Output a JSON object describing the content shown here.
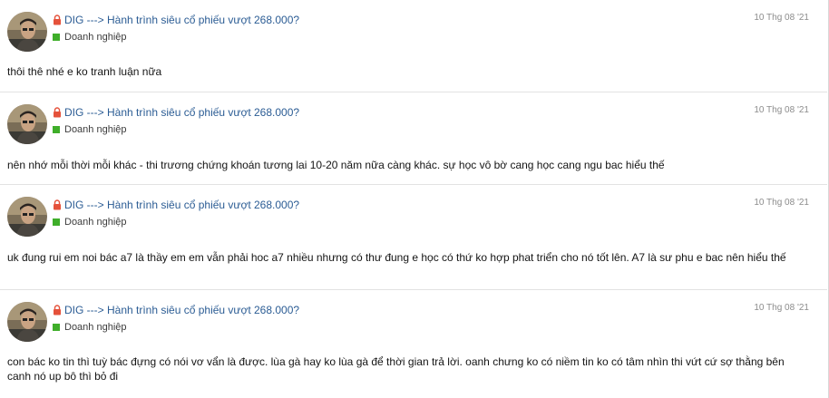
{
  "colors": {
    "link": "#2b5c94",
    "forum_badge": "#3fae2a",
    "lock": "#e5513a",
    "date": "#8c8c8c"
  },
  "posts": [
    {
      "thread_title": "DIG ---> Hành trình siêu cổ phiếu vượt 268.000?",
      "forum": "Doanh nghiệp",
      "date": "10 Thg 08 '21",
      "text": "thôi thê nhé e ko tranh luận nữa",
      "icons": [
        "avatar",
        "lock-icon",
        "forum-badge-icon"
      ]
    },
    {
      "thread_title": "DIG ---> Hành trình siêu cổ phiếu vượt 268.000?",
      "forum": "Doanh nghiệp",
      "date": "10 Thg 08 '21",
      "text": "nên nhớ mỗi thời mỗi khác - thi trương chứng khoán tương lai 10-20 năm nữa càng khác. sự học vô bờ cang học cang ngu bac hiểu thế",
      "icons": [
        "avatar",
        "lock-icon",
        "forum-badge-icon"
      ]
    },
    {
      "thread_title": "DIG ---> Hành trình siêu cổ phiếu vượt 268.000?",
      "forum": "Doanh nghiệp",
      "date": "10 Thg 08 '21",
      "text": "uk đung rui em noi bác a7 là thầy em em vẫn phải hoc a7 nhiều nhưng có thư đung e học có thứ ko hợp phat triển cho nó tốt lên. A7 là sư phu e bac nên hiểu thế",
      "icons": [
        "avatar",
        "lock-icon",
        "forum-badge-icon"
      ]
    },
    {
      "thread_title": "DIG ---> Hành trình siêu cổ phiếu vượt 268.000?",
      "forum": "Doanh nghiệp",
      "date": "10 Thg 08 '21",
      "text": "con bác ko tin thì tuỳ bác đựng có nói vơ vẩn là được. lùa gà hay ko lùa gà để thời gian trả lời. oanh chưng ko có niềm tin ko có tâm nhìn thi vứt cứ sợ thằng bên canh nó up bô thì bỏ đi",
      "icons": [
        "avatar",
        "lock-icon",
        "forum-badge-icon"
      ]
    }
  ]
}
